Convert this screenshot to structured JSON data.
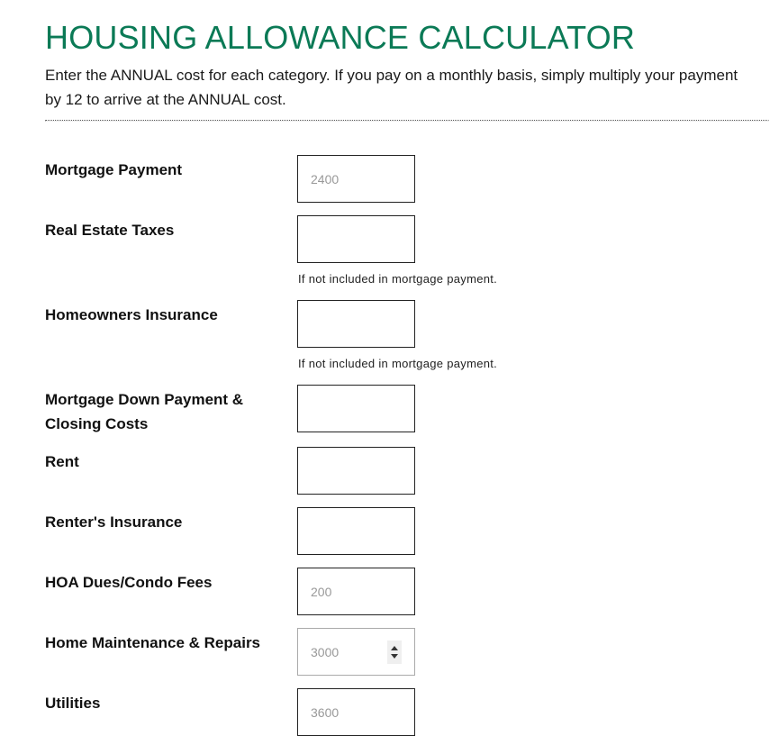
{
  "header": {
    "title": "HOUSING ALLOWANCE CALCULATOR",
    "intro": "Enter the ANNUAL cost for each category. If you pay on a monthly basis, simply multiply your payment by 12 to arrive at the ANNUAL cost."
  },
  "colors": {
    "title": "#0b7a56",
    "text": "#1a1a1a",
    "field_border": "#222222",
    "placeholder": "#999999"
  },
  "fields": [
    {
      "label": "Mortgage Payment",
      "value": "",
      "placeholder": "2400",
      "help": ""
    },
    {
      "label": "Real Estate Taxes",
      "value": "",
      "placeholder": "",
      "help": "If not included in mortgage payment."
    },
    {
      "label": "Homeowners Insurance",
      "value": "",
      "placeholder": "",
      "help": "If not included in mortgage payment."
    },
    {
      "label": "Mortgage Down Payment & Closing Costs",
      "value": "",
      "placeholder": "",
      "help": ""
    },
    {
      "label": "Rent",
      "value": "",
      "placeholder": "",
      "help": ""
    },
    {
      "label": "Renter's Insurance",
      "value": "",
      "placeholder": "",
      "help": ""
    },
    {
      "label": "HOA Dues/Condo Fees",
      "value": "",
      "placeholder": "200",
      "help": ""
    },
    {
      "label": "Home Maintenance & Repairs",
      "value": "",
      "placeholder": "3000",
      "help": "",
      "state": "hover"
    },
    {
      "label": "Utilities",
      "value": "",
      "placeholder": "3600",
      "help": ""
    }
  ]
}
